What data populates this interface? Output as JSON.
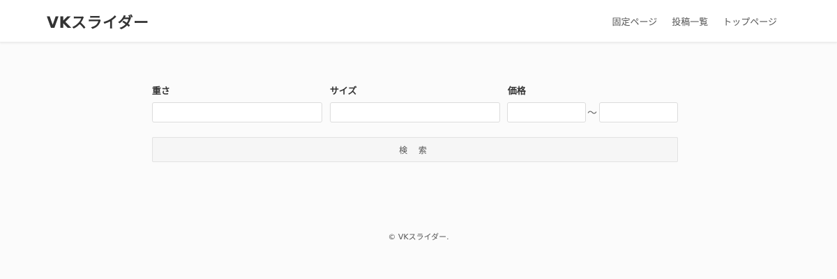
{
  "header": {
    "site_title": "VKスライダー",
    "nav": [
      {
        "label": "固定ページ"
      },
      {
        "label": "投稿一覧"
      },
      {
        "label": "トップページ"
      }
    ]
  },
  "search_form": {
    "weight_label": "重さ",
    "weight_value": "",
    "size_label": "サイズ",
    "size_value": "",
    "price_label": "価格",
    "price_min_value": "",
    "price_max_value": "",
    "range_separator": "～",
    "search_button_label": "検 索"
  },
  "footer": {
    "copyright": "© VKスライダー."
  }
}
